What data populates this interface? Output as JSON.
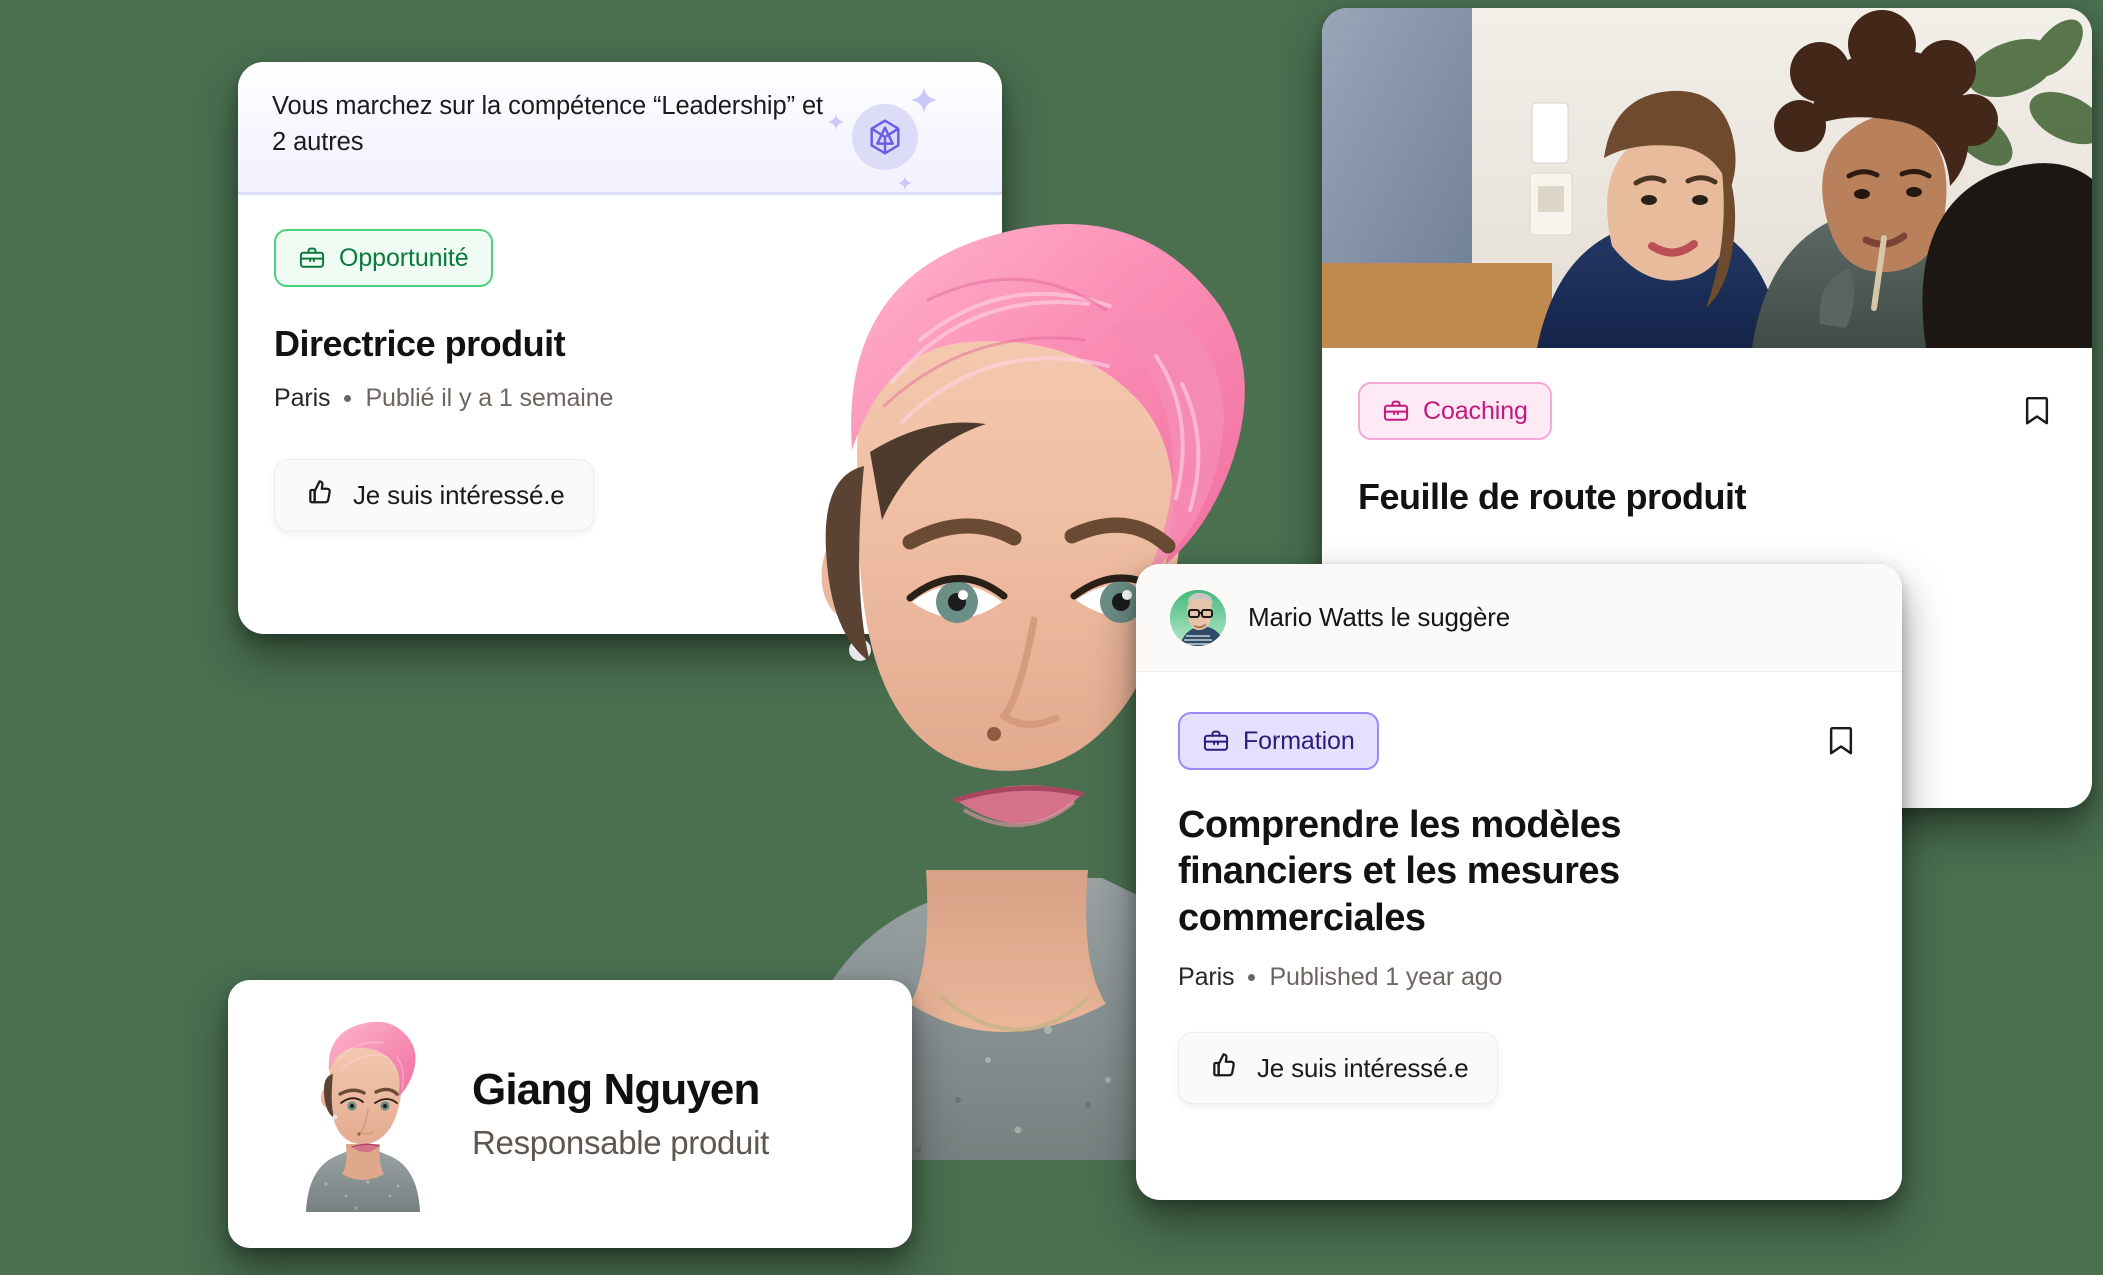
{
  "theme": {
    "background": "#4a7050",
    "card_background": "#ffffff",
    "green_accent": "#4cd07d",
    "green_text": "#0c7a3e",
    "pink_accent": "#f8a8d6",
    "pink_text": "#c2187f",
    "purple_accent": "#9d87fb",
    "purple_text": "#2e1c7a",
    "ai_banner_bg": "#f2f1fe"
  },
  "opportunity_card": {
    "ai_banner": {
      "text": "Vous marchez sur la compétence “Leadership” et 2 autres",
      "icon": "ai-gem-icon"
    },
    "chip": {
      "label": "Opportunité",
      "icon": "briefcase-icon"
    },
    "title": "Directrice produit",
    "meta": {
      "place": "Paris",
      "separator": "•",
      "published": "Publié il y a 1 semaine"
    },
    "action": {
      "label": "Je suis intéressé.e",
      "icon": "thumbs-up-icon"
    }
  },
  "coaching_card": {
    "photo_alt": "two women collaborating at a table",
    "chip": {
      "label": "Coaching",
      "icon": "briefcase-icon"
    },
    "bookmark_icon": "bookmark-icon",
    "title": "Feuille de route produit"
  },
  "formation_card": {
    "suggester": {
      "name": "Mario Watts le suggère",
      "avatar": "avatar-mario"
    },
    "chip": {
      "label": "Formation",
      "icon": "briefcase-icon"
    },
    "bookmark_icon": "bookmark-icon",
    "title": "Comprendre les modèles financiers et les mesures commerciales",
    "meta": {
      "place": "Paris",
      "separator": "•",
      "published": "Published 1 year ago"
    },
    "action": {
      "label": "Je suis intéressé.e",
      "icon": "thumbs-up-icon"
    }
  },
  "profile_card": {
    "name": "Giang Nguyen",
    "role": "Responsable produit",
    "avatar": "avatar-giang"
  },
  "hero": {
    "portrait_alt": "woman with short pink hair in grey marled top"
  }
}
